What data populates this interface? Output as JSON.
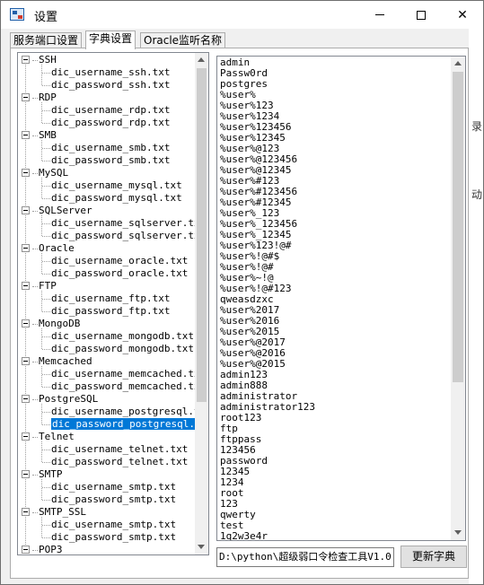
{
  "window": {
    "title": "设置"
  },
  "tabs": [
    {
      "label": "服务端口设置"
    },
    {
      "label": "字典设置"
    },
    {
      "label": "Oracle监听名称"
    }
  ],
  "tree": {
    "services": [
      {
        "name": "SSH",
        "files": [
          "dic_username_ssh.txt",
          "dic_password_ssh.txt"
        ]
      },
      {
        "name": "RDP",
        "files": [
          "dic_username_rdp.txt",
          "dic_password_rdp.txt"
        ]
      },
      {
        "name": "SMB",
        "files": [
          "dic_username_smb.txt",
          "dic_password_smb.txt"
        ]
      },
      {
        "name": "MySQL",
        "files": [
          "dic_username_mysql.txt",
          "dic_password_mysql.txt"
        ]
      },
      {
        "name": "SQLServer",
        "files": [
          "dic_username_sqlserver.txt",
          "dic_password_sqlserver.txt"
        ]
      },
      {
        "name": "Oracle",
        "files": [
          "dic_username_oracle.txt",
          "dic_password_oracle.txt"
        ]
      },
      {
        "name": "FTP",
        "files": [
          "dic_username_ftp.txt",
          "dic_password_ftp.txt"
        ]
      },
      {
        "name": "MongoDB",
        "files": [
          "dic_username_mongodb.txt",
          "dic_password_mongodb.txt"
        ]
      },
      {
        "name": "Memcached",
        "files": [
          "dic_username_memcached.txt",
          "dic_password_memcached.txt"
        ]
      },
      {
        "name": "PostgreSQL",
        "files": [
          "dic_username_postgresql.txt",
          "dic_password_postgresql.txt"
        ]
      },
      {
        "name": "Telnet",
        "files": [
          "dic_username_telnet.txt",
          "dic_password_telnet.txt"
        ]
      },
      {
        "name": "SMTP",
        "files": [
          "dic_username_smtp.txt",
          "dic_password_smtp.txt"
        ]
      },
      {
        "name": "SMTP_SSL",
        "files": [
          "dic_username_smtp.txt",
          "dic_password_smtp.txt"
        ]
      },
      {
        "name": "POP3",
        "files": []
      }
    ],
    "selected": "dic_password_postgresql.txt"
  },
  "dictionary": {
    "lines": [
      "admin",
      "Passw0rd",
      "postgres",
      "%user%",
      "%user%123",
      "%user%1234",
      "%user%123456",
      "%user%12345",
      "%user%@123",
      "%user%@123456",
      "%user%@12345",
      "%user%#123",
      "%user%#123456",
      "%user%#12345",
      "%user%_123",
      "%user%_123456",
      "%user%_12345",
      "%user%123!@#",
      "%user%!@#$",
      "%user%!@#",
      "%user%~!@",
      "%user%!@#123",
      "qweasdzxc",
      "%user%2017",
      "%user%2016",
      "%user%2015",
      "%user%@2017",
      "%user%@2016",
      "%user%@2015",
      "admin123",
      "admin888",
      "administrator",
      "administrator123",
      "root123",
      "ftp",
      "ftppass",
      "123456",
      "password",
      "12345",
      "1234",
      "root",
      "123",
      "qwerty",
      "test",
      "1q2w3e4r"
    ]
  },
  "path_field": {
    "value": "D:\\python\\超级弱口令检查工具V1.0"
  },
  "buttons": {
    "update_dictionary": "更新字典"
  }
}
